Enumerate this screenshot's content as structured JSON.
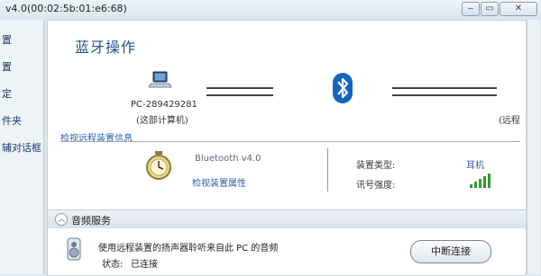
{
  "window": {
    "title": "v4.0(00:02:5b:01:e6:68)"
  },
  "sidebar": {
    "items": [
      {
        "label": "置"
      },
      {
        "label": "置"
      },
      {
        "label": "定"
      },
      {
        "label": "件夹"
      },
      {
        "label": "辅对话框"
      }
    ]
  },
  "main": {
    "title": "蓝牙操作",
    "local_device": {
      "name": "PC-289429281",
      "subtitle": "(这部计算机)"
    },
    "remote_device": {
      "subtitle": "(远程"
    },
    "link_check_remote": "检视远程装置信息",
    "bluetooth_version": "Bluetooth v4.0",
    "link_view_properties": "检视装置属性",
    "device_type_label": "装置类型:",
    "device_type_value": "耳机",
    "signal_strength_label": "讯号强度:",
    "signal_strength_bars": 5
  },
  "audio_service": {
    "header": "音频服务",
    "description": "使用远程装置的扬声器聆听来自此 PC 的音频",
    "status_label": "状态:",
    "status_value": "已连接",
    "disconnect_button": "中断连接"
  },
  "colors": {
    "title_blue": "#1f4f8f",
    "link_blue": "#2a5ea8",
    "bluetooth_blue": "#1565c0",
    "signal_green": "#2e9d2a"
  },
  "icons": {
    "local_device": "laptop-icon",
    "remote_device": "bluetooth-icon",
    "device_props": "stopwatch-icon",
    "audio": "speaker-icon"
  }
}
